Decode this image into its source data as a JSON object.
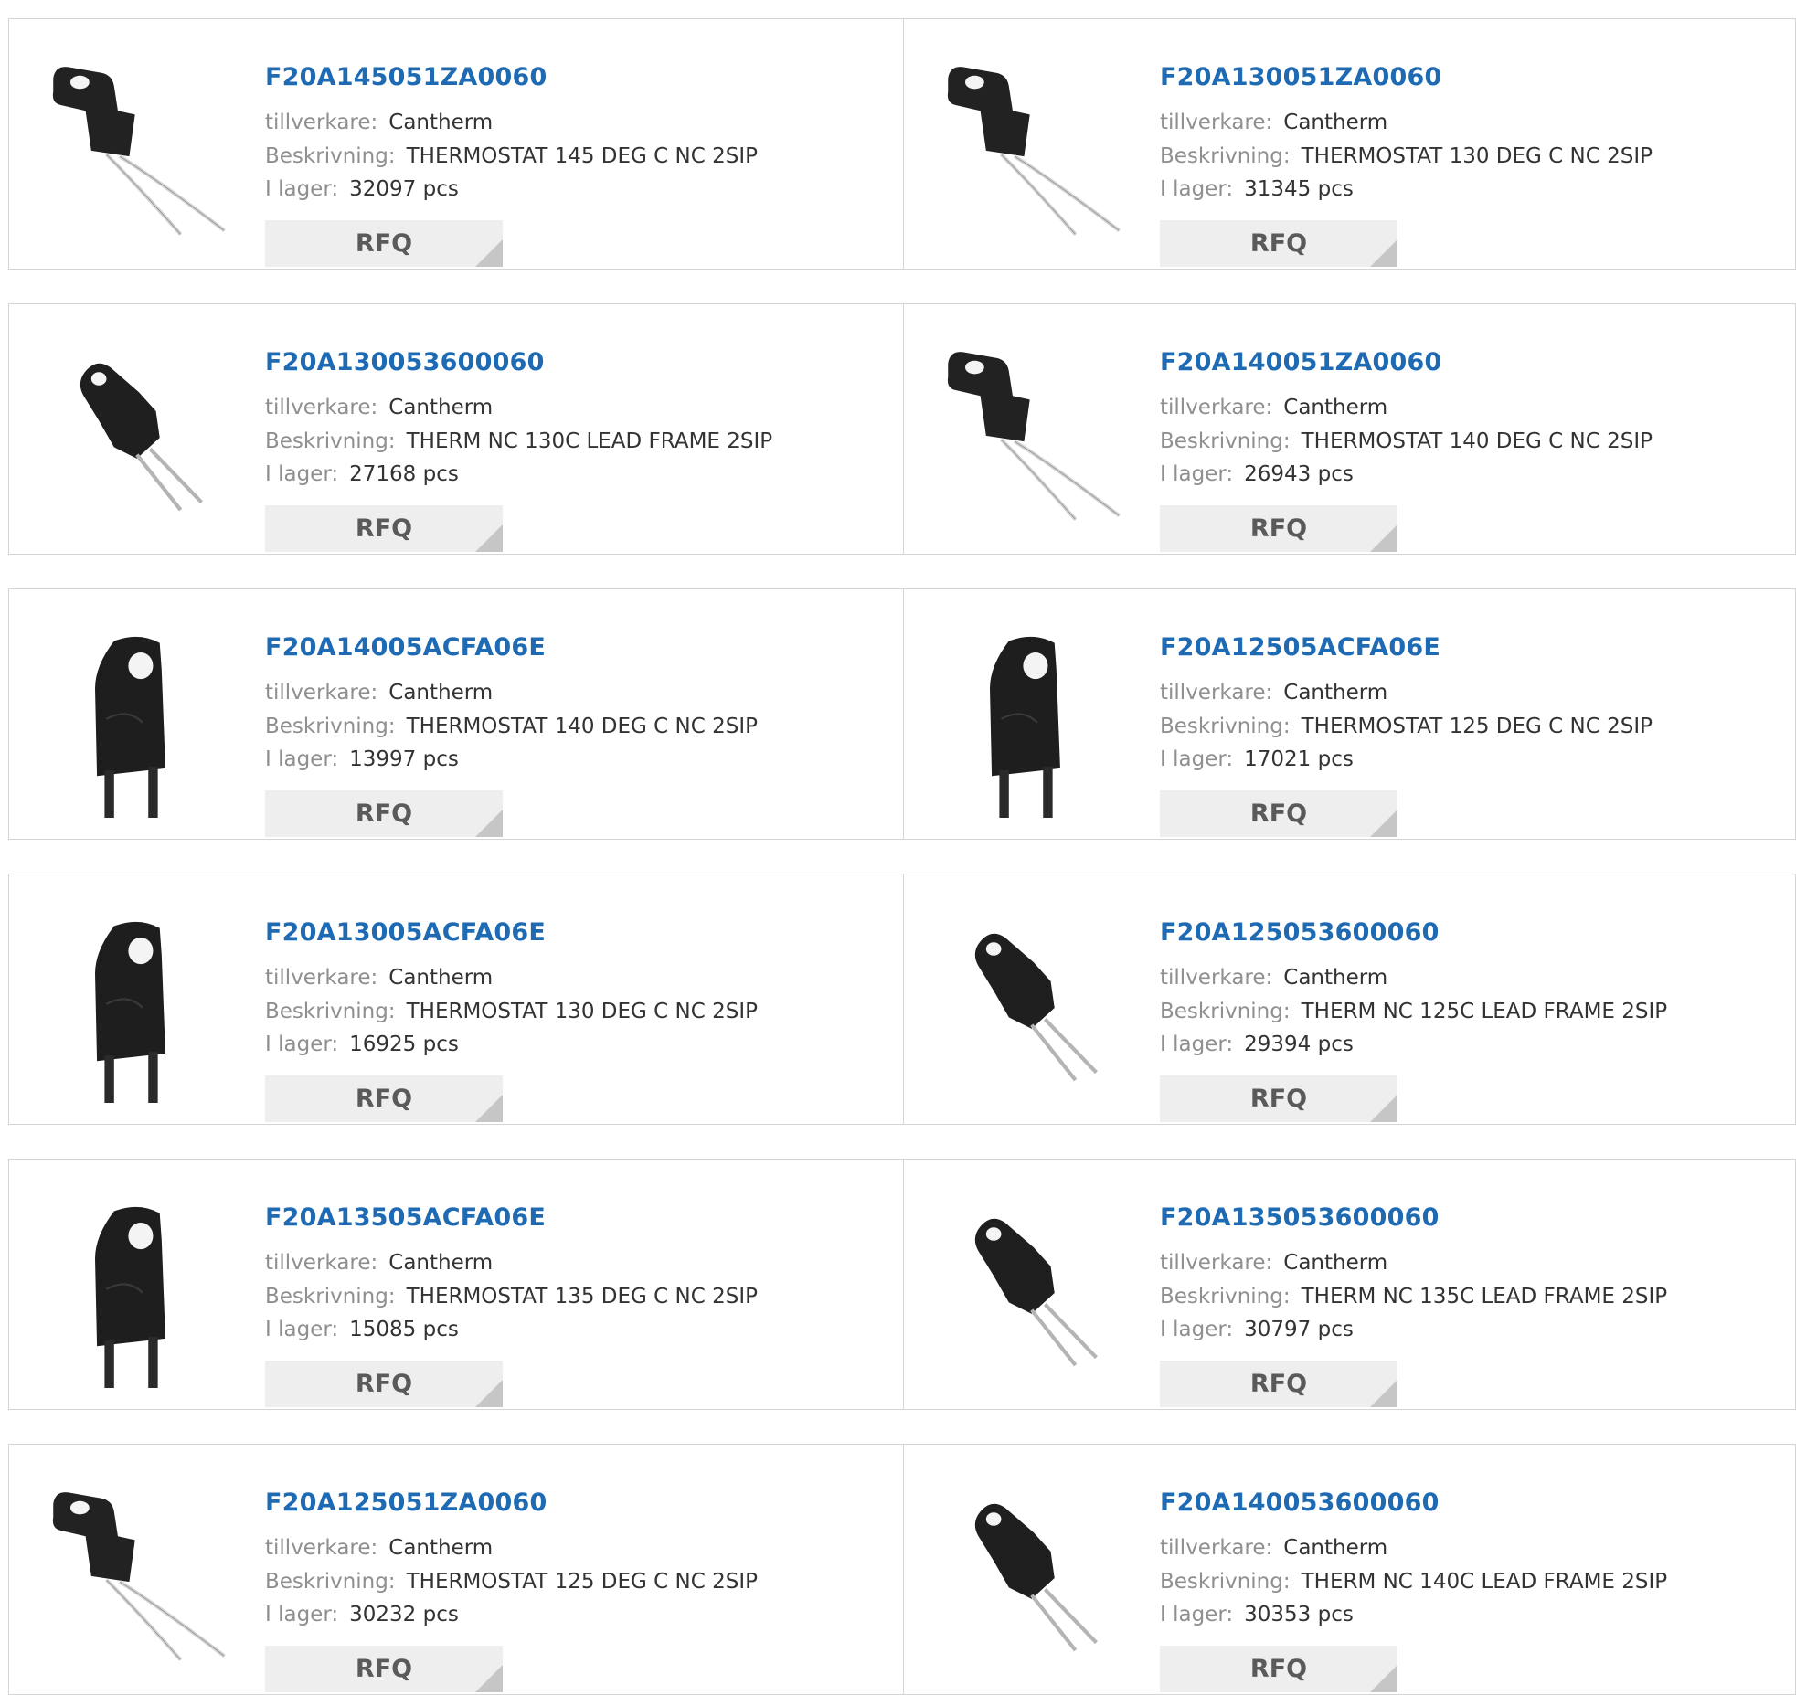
{
  "labels": {
    "manufacturer": "tillverkare:",
    "description": "Beskrivning:",
    "stock": "I lager:",
    "rfq": "RFQ"
  },
  "products": [
    {
      "part": "F20A145051ZA0060",
      "manufacturer": "Cantherm",
      "description": "THERMOSTAT 145 DEG C NC 2SIP",
      "stock": "32097 pcs",
      "image": "bent-lead-icon"
    },
    {
      "part": "F20A130051ZA0060",
      "manufacturer": "Cantherm",
      "description": "THERMOSTAT 130 DEG C NC 2SIP",
      "stock": "31345 pcs",
      "image": "bent-lead-icon"
    },
    {
      "part": "F20A130053600060",
      "manufacturer": "Cantherm",
      "description": "THERM NC 130C LEAD FRAME 2SIP",
      "stock": "27168 pcs",
      "image": "lead-frame-icon"
    },
    {
      "part": "F20A140051ZA0060",
      "manufacturer": "Cantherm",
      "description": "THERMOSTAT 140 DEG C NC 2SIP",
      "stock": "26943 pcs",
      "image": "bent-lead-icon"
    },
    {
      "part": "F20A14005ACFA06E",
      "manufacturer": "Cantherm",
      "description": "THERMOSTAT 140 DEG C NC 2SIP",
      "stock": "13997 pcs",
      "image": "upright-package-icon"
    },
    {
      "part": "F20A12505ACFA06E",
      "manufacturer": "Cantherm",
      "description": "THERMOSTAT 125 DEG C NC 2SIP",
      "stock": "17021 pcs",
      "image": "upright-package-icon"
    },
    {
      "part": "F20A13005ACFA06E",
      "manufacturer": "Cantherm",
      "description": "THERMOSTAT 130 DEG C NC 2SIP",
      "stock": "16925 pcs",
      "image": "upright-package-icon"
    },
    {
      "part": "F20A125053600060",
      "manufacturer": "Cantherm",
      "description": "THERM NC 125C LEAD FRAME 2SIP",
      "stock": "29394 pcs",
      "image": "lead-frame-icon"
    },
    {
      "part": "F20A13505ACFA06E",
      "manufacturer": "Cantherm",
      "description": "THERMOSTAT 135 DEG C NC 2SIP",
      "stock": "15085 pcs",
      "image": "upright-package-icon"
    },
    {
      "part": "F20A135053600060",
      "manufacturer": "Cantherm",
      "description": "THERM NC 135C LEAD FRAME 2SIP",
      "stock": "30797 pcs",
      "image": "lead-frame-icon"
    },
    {
      "part": "F20A125051ZA0060",
      "manufacturer": "Cantherm",
      "description": "THERMOSTAT 125 DEG C NC 2SIP",
      "stock": "30232 pcs",
      "image": "bent-lead-icon"
    },
    {
      "part": "F20A140053600060",
      "manufacturer": "Cantherm",
      "description": "THERM NC 140C LEAD FRAME 2SIP",
      "stock": "30353 pcs",
      "image": "lead-frame-icon"
    }
  ]
}
